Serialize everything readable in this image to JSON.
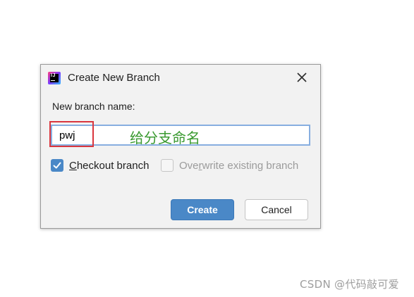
{
  "dialog": {
    "title": "Create New Branch",
    "app_icon": "intellij-idea-icon",
    "close_icon": "close-icon"
  },
  "form": {
    "name_label": "New branch name:",
    "name_value": "pwj",
    "checkout": {
      "label_mnemonic": "C",
      "label_rest": "heckout branch",
      "checked": true
    },
    "overwrite": {
      "label_prefix": "Ove",
      "label_mnemonic": "r",
      "label_rest": "write existing branch",
      "checked": false,
      "disabled": true
    }
  },
  "buttons": {
    "create_label": "Create",
    "cancel_label": "Cancel"
  },
  "annotation": {
    "text": "给分支命名",
    "color": "#3a9a30",
    "highlight_color": "#d9363e"
  },
  "watermark": {
    "text": "CSDN @代码敲可爱"
  },
  "colors": {
    "accent": "#4a88c7",
    "input_focus_border": "#87aee0",
    "dialog_bg": "#f2f2f2"
  }
}
